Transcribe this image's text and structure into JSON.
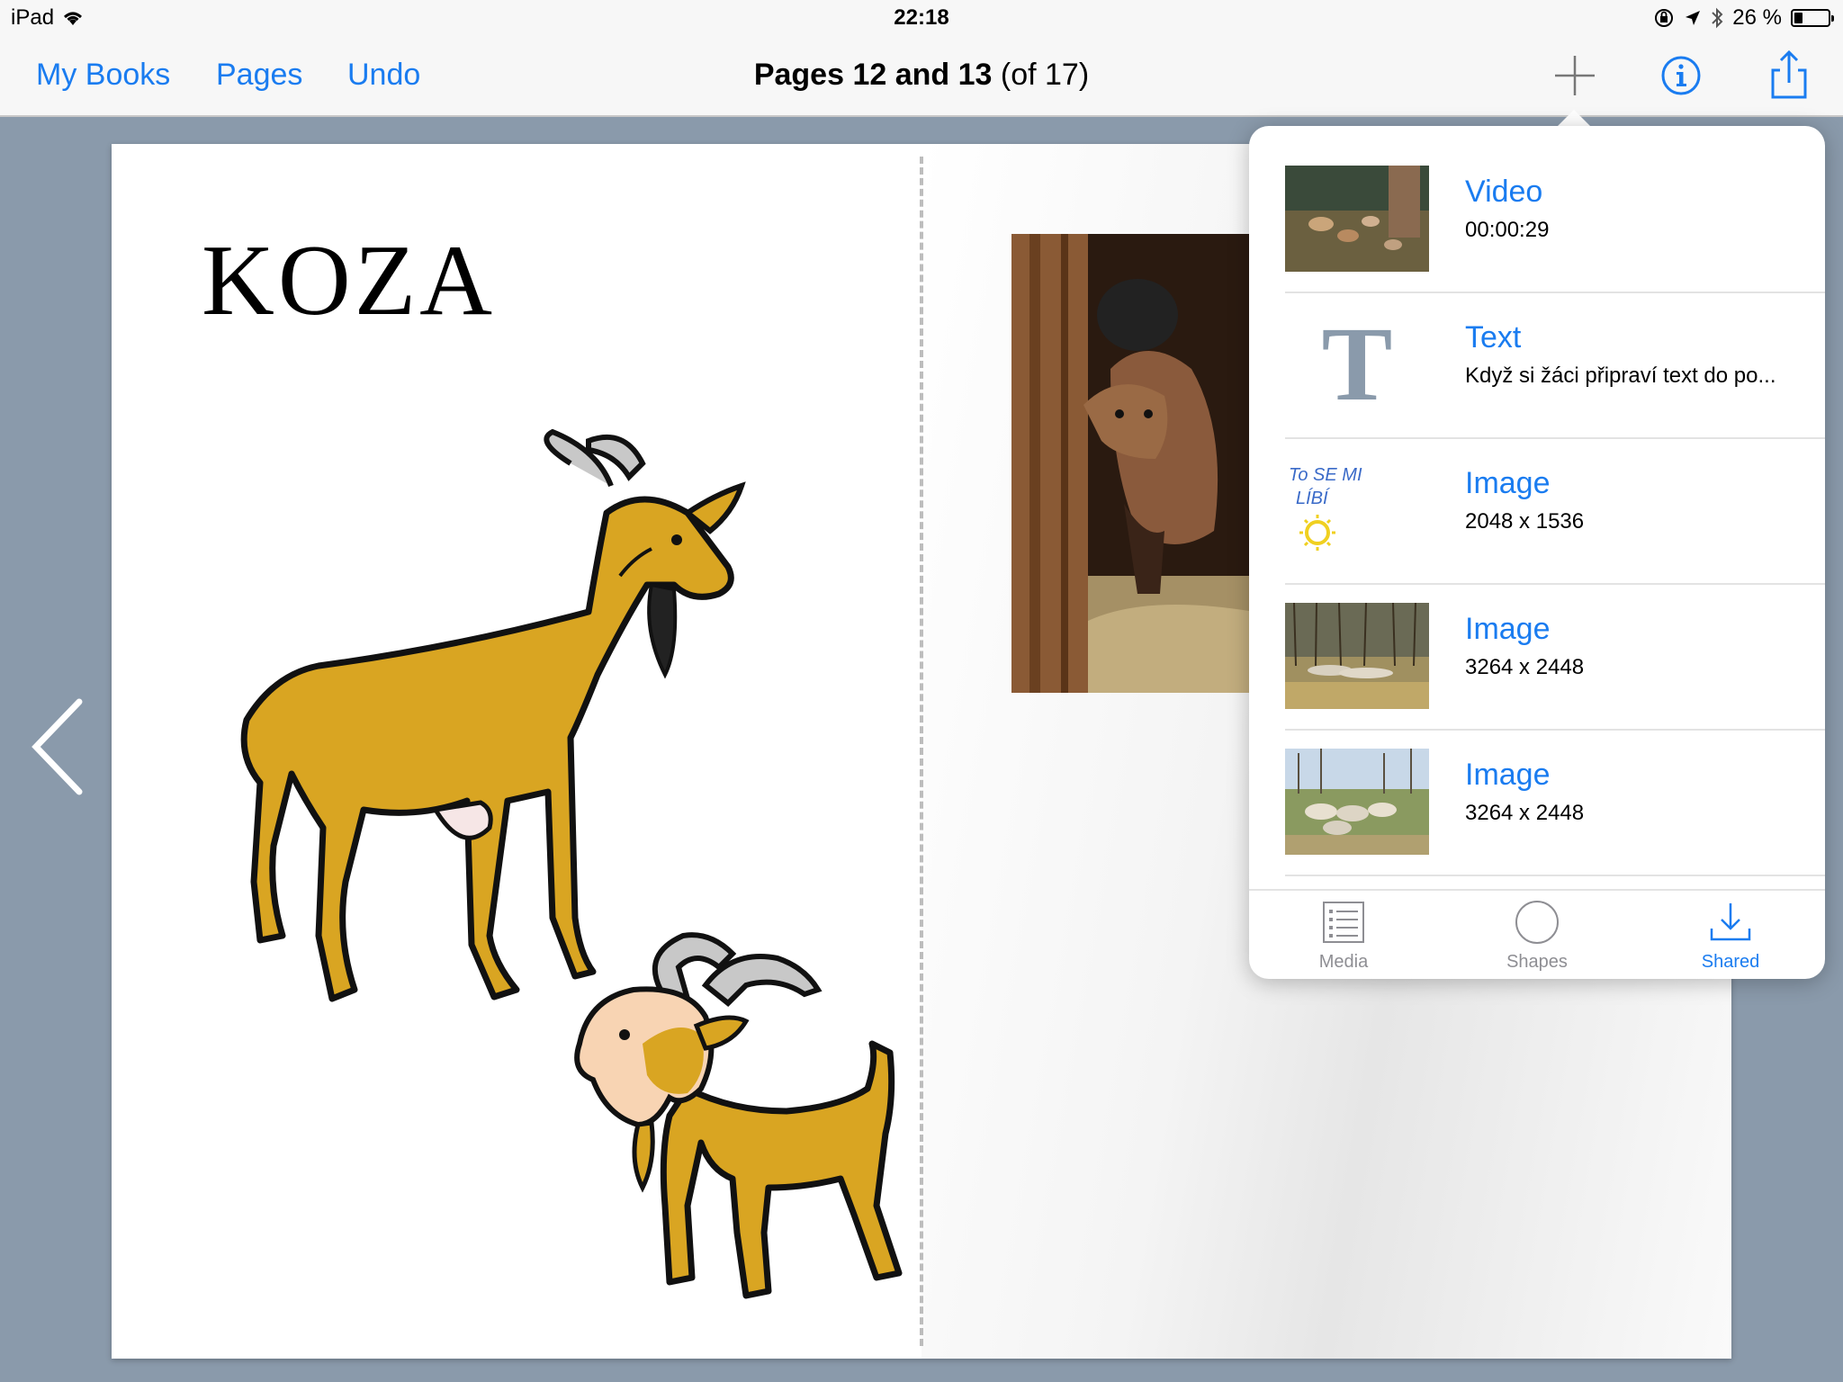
{
  "status_bar": {
    "device": "iPad",
    "time": "22:18",
    "battery": "26 %",
    "battery_level": 0.26
  },
  "nav": {
    "my_books": "My Books",
    "pages": "Pages",
    "undo": "Undo",
    "title_bold": "Pages 12 and 13",
    "title_rest": " (of 17)",
    "icons": [
      "plus-icon",
      "info-icon",
      "share-icon"
    ]
  },
  "page": {
    "heading": "KOZA"
  },
  "popover": {
    "items": [
      {
        "title": "Video",
        "subtitle": "00:00:29"
      },
      {
        "title": "Text",
        "subtitle": "Když si žáci připraví text do po..."
      },
      {
        "title": "Image",
        "subtitle": "2048 x 1536",
        "thumb_text_1": "To SE MI",
        "thumb_text_2": "LÍBÍ"
      },
      {
        "title": "Image",
        "subtitle": "3264 x 2448"
      },
      {
        "title": "Image",
        "subtitle": "3264 x 2448"
      }
    ],
    "tabs": [
      {
        "label": "Media",
        "icon": "list-icon"
      },
      {
        "label": "Shapes",
        "icon": "circle-icon"
      },
      {
        "label": "Shared",
        "icon": "download-icon",
        "active": true
      }
    ]
  },
  "colors": {
    "accent": "#1a7cf0",
    "goat_body": "#d9a522",
    "background": "#8a9aab"
  }
}
